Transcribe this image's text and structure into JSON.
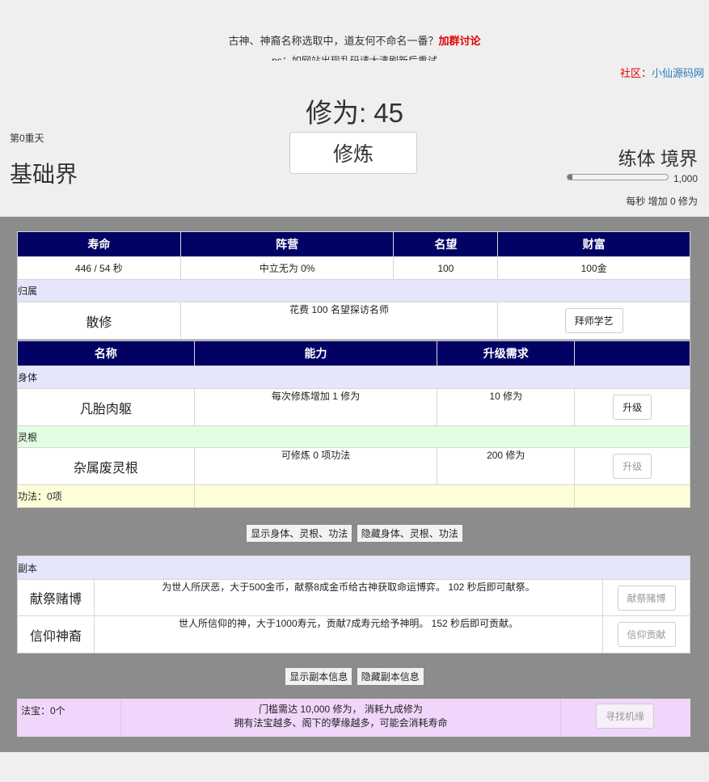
{
  "header": {
    "notice_text": "古神、神裔名称选取中，道友何不命名一番？",
    "notice_link": "加群讨论",
    "notice2": "ps：如网站出现乱码请大清刷新后重试",
    "community_label": "社区：",
    "community_link": "小仙源码网",
    "cultivation_label": "修为: 45",
    "train_button": "修炼",
    "heaven_label": "第0重天",
    "world_name": "基础界",
    "realm": "练体 境界",
    "progress_fraction": 0.045,
    "progress_max": "1,000",
    "rate_text": "每秒 增加 0 修为"
  },
  "stats": {
    "headers": [
      "寿命",
      "阵营",
      "名望",
      "财富"
    ],
    "values": [
      "446 / 54 秒",
      "中立无为 0%",
      "100",
      "100金"
    ],
    "affiliation_label": "归属",
    "sect": "散修",
    "sect_desc": "花费 100 名望探访名师",
    "sect_button": "拜师学艺"
  },
  "skills": {
    "headers": [
      "名称",
      "能力",
      "升级需求",
      ""
    ],
    "body_label": "身体",
    "body_name": "凡胎肉躯",
    "body_ability": "每次修炼增加 1 修为",
    "body_req": "10 修为",
    "body_button": "升级",
    "root_label": "灵根",
    "root_name": "杂属废灵根",
    "root_ability": "可修炼 0 项功法",
    "root_req": "200 修为",
    "root_button": "升级",
    "gongfa_label": "功法：0项"
  },
  "toggles1": {
    "show": "显示身体、灵根、功法",
    "hide": "隐藏身体、灵根、功法"
  },
  "dungeon": {
    "label": "副本",
    "row1_name": "献祭赌博",
    "row1_desc": "为世人所厌恶，大于500金币，献祭8成金币给古神获取命运博弈。 102 秒后即可献祭。",
    "row1_button": "献祭赌博",
    "row2_name": "信仰神裔",
    "row2_desc": "世人所信仰的神，大于1000寿元，贡献7成寿元给予神明。 152 秒后即可贡献。",
    "row2_button": "信仰贡献"
  },
  "toggles2": {
    "show": "显示副本信息",
    "hide": "隐藏副本信息"
  },
  "fabao": {
    "label": "法宝：0个",
    "line1": "门槛需达 10,000 修为， 消耗九成修为",
    "line2": "拥有法宝越多、阁下的孽缘越多，可能会消耗寿命",
    "button": "寻找机缘"
  }
}
